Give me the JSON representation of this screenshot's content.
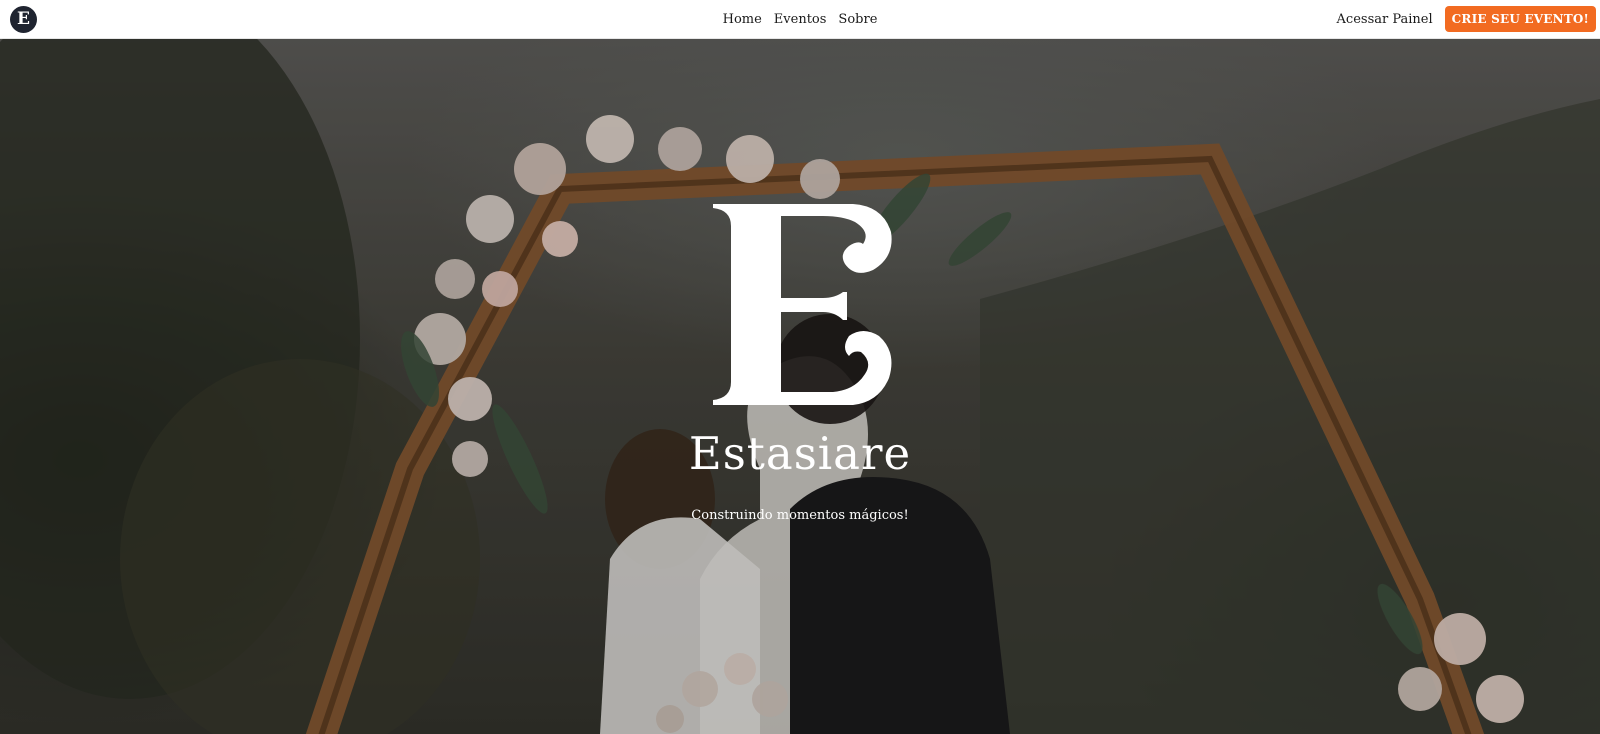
{
  "navbar": {
    "logo_letter": "E",
    "links": [
      "Home",
      "Eventos",
      "Sobre"
    ],
    "login_label": "Acessar Painel",
    "cta_label": "CRIE SEU EVENTO!"
  },
  "hero": {
    "brand_mark_letter": "E",
    "title": "Estasiare",
    "tagline": "Construindo momentos mágicos!"
  },
  "colors": {
    "accent": "#f26b21",
    "logo_bg": "#1f2430",
    "hero_text": "#ffffff"
  }
}
